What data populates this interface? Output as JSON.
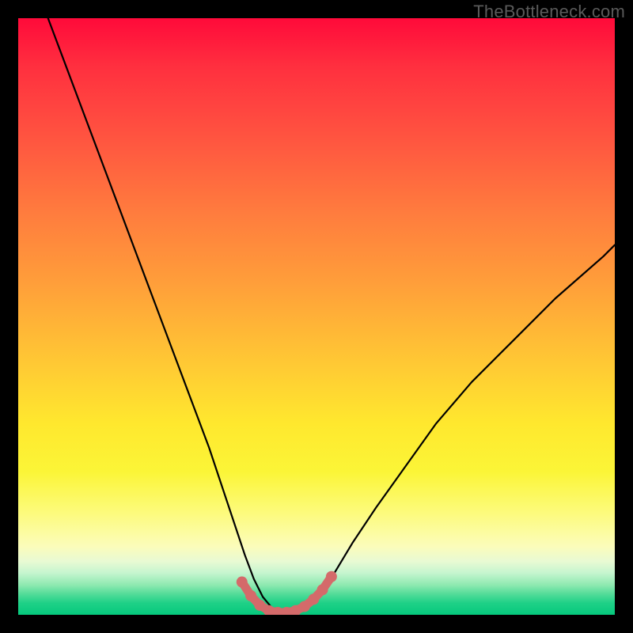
{
  "watermark": {
    "text": "TheBottleneck.com"
  },
  "colors": {
    "curve_stroke": "#000000",
    "marker_fill": "#d46a6a",
    "marker_stroke": "#d46a6a"
  },
  "chart_data": {
    "type": "line",
    "title": "",
    "xlabel": "",
    "ylabel": "",
    "xlim": [
      0,
      100
    ],
    "ylim": [
      0,
      100
    ],
    "grid": false,
    "legend": false,
    "series": [
      {
        "name": "bottleneck-curve",
        "x": [
          5,
          8,
          11,
          14,
          17,
          20,
          23,
          26,
          29,
          32,
          34,
          36,
          38,
          39.5,
          41,
          42.5,
          44,
          46,
          48,
          50,
          53,
          56,
          60,
          65,
          70,
          76,
          83,
          90,
          98,
          100
        ],
        "y": [
          100,
          92,
          84,
          76,
          68,
          60,
          52,
          44,
          36,
          28,
          22,
          16,
          10,
          6,
          3,
          1.2,
          0.4,
          0.4,
          1.2,
          3,
          7,
          12,
          18,
          25,
          32,
          39,
          46,
          53,
          60,
          62
        ]
      }
    ],
    "markers": {
      "name": "trough-markers",
      "x": [
        37.5,
        39,
        40.5,
        42,
        43.5,
        45,
        46.5,
        48,
        49.5,
        51,
        52.5
      ],
      "y": [
        5.5,
        3.2,
        1.6,
        0.7,
        0.4,
        0.4,
        0.7,
        1.4,
        2.6,
        4.2,
        6.4
      ]
    }
  }
}
